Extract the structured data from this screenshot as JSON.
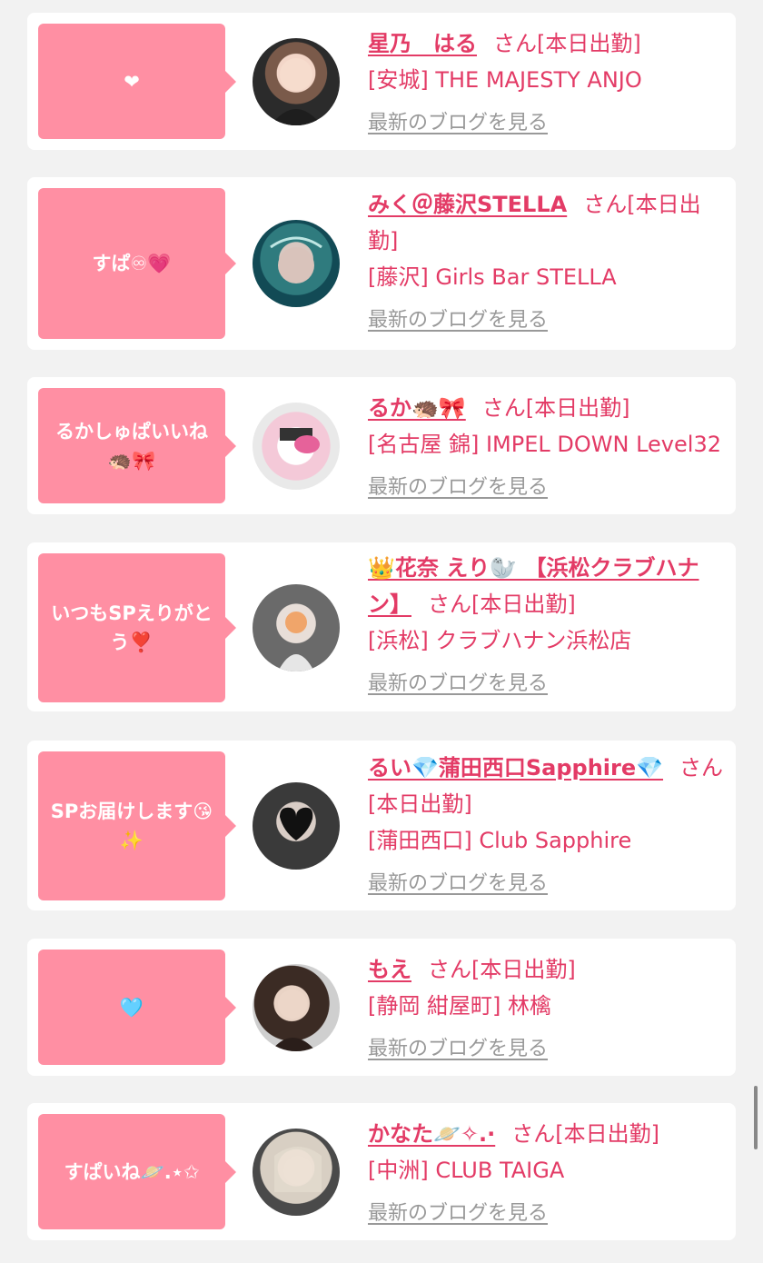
{
  "colors": {
    "accent": "#e33b66",
    "bubble": "#ff8fa3",
    "link_gray": "#999999",
    "background": "#f2f2f2"
  },
  "items": [
    {
      "message": "❤",
      "name": "星乃　はる",
      "suffix": "さん[本日出勤]",
      "shop": "[安城] THE MAJESTY ANJO",
      "blog": "最新のブログを見る"
    },
    {
      "message": "すぱ♾💗",
      "name": "みく＠藤沢STELLA",
      "suffix": "さん[本日出勤]",
      "shop": "[藤沢] Girls Bar STELLA",
      "blog": "最新のブログを見る"
    },
    {
      "message": "るかしゅぱいいね🦔🎀",
      "name": "るか🦔🎀",
      "suffix": "さん[本日出勤]",
      "shop": "[名古屋 錦] IMPEL DOWN Level32",
      "blog": "最新のブログを見る"
    },
    {
      "message": "いつもSPえりがとう❣️",
      "name": "👑花奈 えり🦭 【浜松クラブハナン】",
      "suffix": "さん[本日出勤]",
      "shop": "[浜松] クラブハナン浜松店",
      "blog": "最新のブログを見る"
    },
    {
      "message": "SPお届けします😘✨",
      "name": "るい💎蒲田西口Sapphire💎",
      "suffix": "さん[本日出勤]",
      "shop": "[蒲田西口] Club Sapphire",
      "blog": "最新のブログを見る"
    },
    {
      "message": "🩵",
      "name": "もえ",
      "suffix": "さん[本日出勤]",
      "shop": "[静岡 紺屋町] 林檎",
      "blog": "最新のブログを見る"
    },
    {
      "message": "すぱいね🪐.⋆✩",
      "name": "かなた🪐✧.·",
      "suffix": "さん[本日出勤]",
      "shop": "[中洲] CLUB TAIGA",
      "blog": "最新のブログを見る"
    }
  ]
}
